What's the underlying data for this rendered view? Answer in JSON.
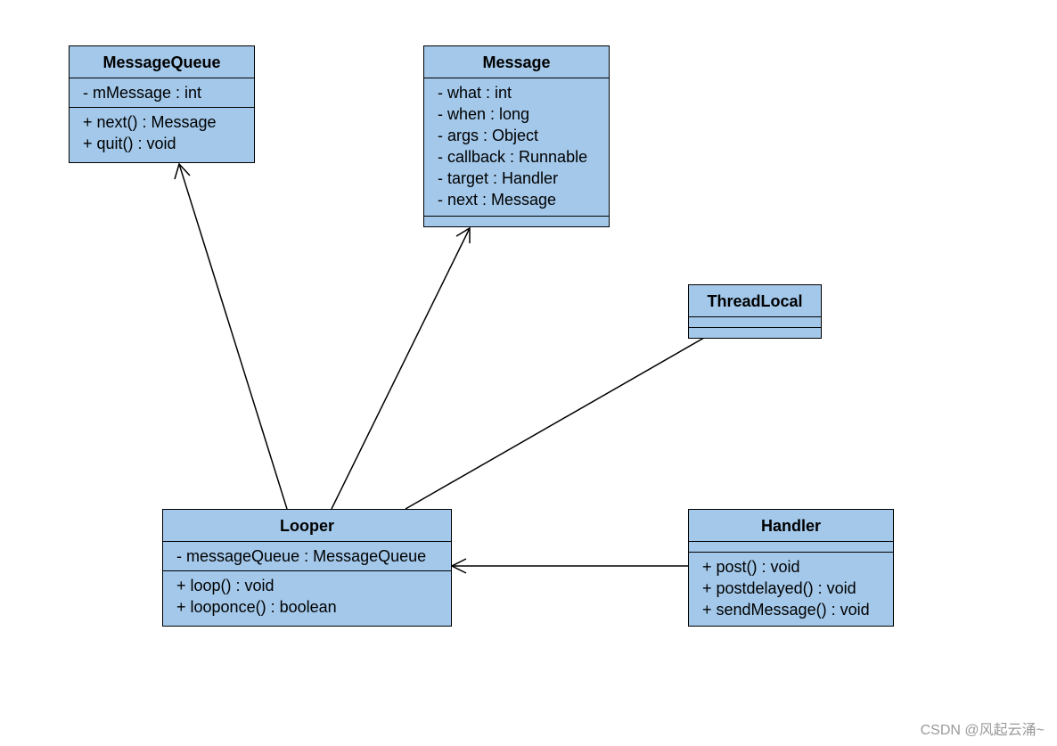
{
  "classes": {
    "messagequeue": {
      "name": "MessageQueue",
      "attributes": [
        "- mMessage : int"
      ],
      "methods": [
        "+ next() : Message",
        "+ quit() : void"
      ]
    },
    "message": {
      "name": "Message",
      "attributes": [
        "- what : int",
        "- when : long",
        "- args : Object",
        "- callback : Runnable",
        "- target : Handler",
        "- next : Message"
      ],
      "methods": []
    },
    "threadlocal": {
      "name": "ThreadLocal",
      "attributes": [],
      "methods": []
    },
    "looper": {
      "name": "Looper",
      "attributes": [
        "- messageQueue : MessageQueue"
      ],
      "methods": [
        "+ loop() : void",
        "+ looponce() : boolean"
      ]
    },
    "handler": {
      "name": "Handler",
      "attributes": [],
      "methods": [
        "+ post() : void",
        "+ postdelayed() : void",
        "+ sendMessage() : void"
      ]
    }
  },
  "relations": [
    {
      "from": "Looper",
      "to": "MessageQueue",
      "type": "navigable-association"
    },
    {
      "from": "Looper",
      "to": "Message",
      "type": "navigable-association"
    },
    {
      "from": "Looper",
      "to": "ThreadLocal",
      "type": "association"
    },
    {
      "from": "Handler",
      "to": "Looper",
      "type": "navigable-association"
    }
  ],
  "colors": {
    "class_fill": "#a3c8ea",
    "line": "#000000"
  },
  "watermark": "CSDN @风起云涌~"
}
